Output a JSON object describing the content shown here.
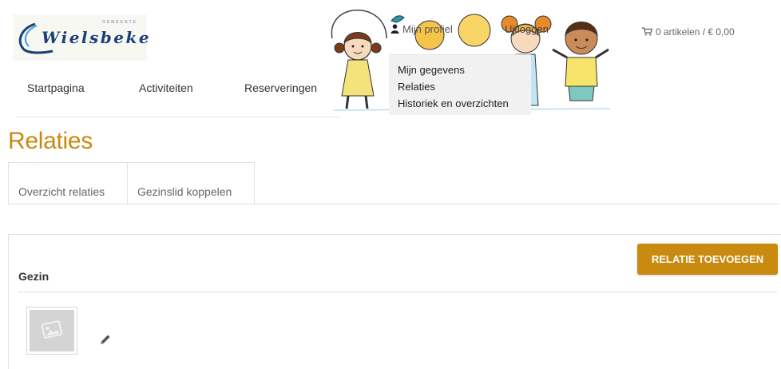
{
  "logo": {
    "subtitle": "GEMEENTE",
    "wordmark": "Wielsbeke",
    "color": "#1c3f7a"
  },
  "nav": {
    "items": [
      {
        "label": "Startpagina"
      },
      {
        "label": "Activiteiten"
      },
      {
        "label": "Reserveringen"
      }
    ]
  },
  "header": {
    "profile_label": "Mijn profiel",
    "profile_icon": "user-icon",
    "logout_label": "Uitloggen",
    "cart_label": "0 artikelen / € 0,00",
    "cart_icon": "cart-icon"
  },
  "profile_menu": {
    "items": [
      {
        "label": "Mijn gegevens"
      },
      {
        "label": "Relaties"
      },
      {
        "label": "Historiek en overzichten"
      }
    ]
  },
  "page": {
    "title": "Relaties",
    "accent_color": "#c98a10"
  },
  "tabs": [
    {
      "label": "Overzicht relaties"
    },
    {
      "label": "Gezinslid koppelen"
    }
  ],
  "family": {
    "heading": "Gezin",
    "add_button": "RELATIE TOEVOEGEN",
    "member_photo_icon": "image-placeholder-icon",
    "edit_icon": "pencil-icon"
  }
}
